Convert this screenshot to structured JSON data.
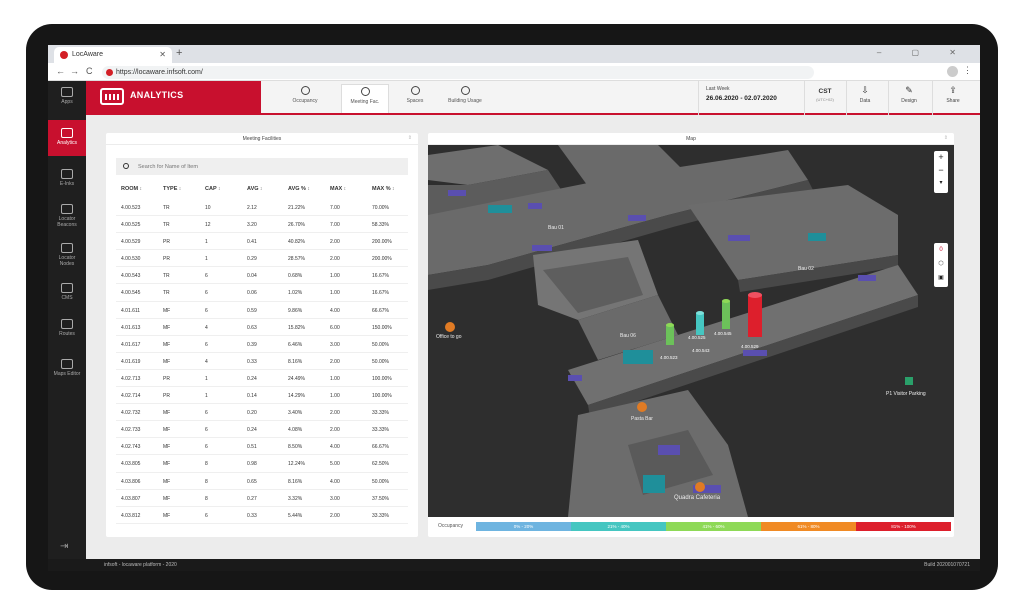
{
  "browser": {
    "tab_title": "LocAware",
    "tab_close": "✕",
    "new_tab": "+",
    "back": "←",
    "forward": "→",
    "reload": "C",
    "url": "https://locaware.infsoft.com/",
    "window_controls": "– ▢ ✕",
    "menu": "⋮"
  },
  "sidebar": {
    "items": [
      {
        "label": "Apps",
        "icon": "apps-icon"
      },
      {
        "label": "Analytics",
        "icon": "analytics-icon"
      },
      {
        "label": "E-Inks",
        "icon": "eink-icon"
      },
      {
        "label": "Locator Beacons",
        "icon": "beacon-icon"
      },
      {
        "label": "Locator Nodes",
        "icon": "node-icon"
      },
      {
        "label": "CMS",
        "icon": "cms-icon"
      },
      {
        "label": "Routes",
        "icon": "routes-icon"
      },
      {
        "label": "Maps Editor",
        "icon": "map-editor-icon"
      }
    ],
    "exit": "⇥"
  },
  "header": {
    "title": "ANALYTICS",
    "tabs": [
      "Occupancy",
      "Meeting Fac.",
      "Spaces",
      "Building Usage"
    ],
    "date_label": "Last Week",
    "date_range": "26.06.2020 - 02.07.2020",
    "timezone": "CST",
    "timezone_sub": "(UTC+02)",
    "buttons": [
      {
        "label": "Data",
        "glyph": "⇩"
      },
      {
        "label": "Design",
        "glyph": "✎"
      },
      {
        "label": "Share",
        "glyph": "⇪"
      }
    ]
  },
  "facilities": {
    "title": "Meeting Facilities",
    "pin": "⇕",
    "search_placeholder": "Search for Name of Item",
    "columns": [
      "ROOM",
      "TYPE",
      "CAP",
      "AVG",
      "AVG %",
      "MAX",
      "MAX %"
    ],
    "rows": [
      [
        "4.00.523",
        "TR",
        "10",
        "2.12",
        "21.22%",
        "7.00",
        "70.00%"
      ],
      [
        "4.00.525",
        "TR",
        "12",
        "3.20",
        "26.70%",
        "7.00",
        "58.33%"
      ],
      [
        "4.00.529",
        "PR",
        "1",
        "0.41",
        "40.82%",
        "2.00",
        "200.00%"
      ],
      [
        "4.00.530",
        "PR",
        "1",
        "0.29",
        "28.57%",
        "2.00",
        "200.00%"
      ],
      [
        "4.00.543",
        "TR",
        "6",
        "0.04",
        "0.68%",
        "1.00",
        "16.67%"
      ],
      [
        "4.00.545",
        "TR",
        "6",
        "0.06",
        "1.02%",
        "1.00",
        "16.67%"
      ],
      [
        "4.01.611",
        "MF",
        "6",
        "0.59",
        "9.86%",
        "4.00",
        "66.67%"
      ],
      [
        "4.01.613",
        "MF",
        "4",
        "0.63",
        "15.82%",
        "6.00",
        "150.00%"
      ],
      [
        "4.01.617",
        "MF",
        "6",
        "0.39",
        "6.46%",
        "3.00",
        "50.00%"
      ],
      [
        "4.01.619",
        "MF",
        "4",
        "0.33",
        "8.16%",
        "2.00",
        "50.00%"
      ],
      [
        "4.02.713",
        "PR",
        "1",
        "0.24",
        "24.49%",
        "1.00",
        "100.00%"
      ],
      [
        "4.02.714",
        "PR",
        "1",
        "0.14",
        "14.29%",
        "1.00",
        "100.00%"
      ],
      [
        "4.02.732",
        "MF",
        "6",
        "0.20",
        "3.40%",
        "2.00",
        "33.33%"
      ],
      [
        "4.02.733",
        "MF",
        "6",
        "0.24",
        "4.08%",
        "2.00",
        "33.33%"
      ],
      [
        "4.02.743",
        "MF",
        "6",
        "0.51",
        "8.50%",
        "4.00",
        "66.67%"
      ],
      [
        "4.03.805",
        "MF",
        "8",
        "0.98",
        "12.24%",
        "5.00",
        "62.50%"
      ],
      [
        "4.03.806",
        "MF",
        "8",
        "0.65",
        "8.16%",
        "4.00",
        "50.00%"
      ],
      [
        "4.03.807",
        "MF",
        "8",
        "0.27",
        "3.32%",
        "3.00",
        "37.50%"
      ],
      [
        "4.03.812",
        "MF",
        "6",
        "0.33",
        "5.44%",
        "2.00",
        "33.33%"
      ]
    ]
  },
  "map": {
    "title": "Map",
    "pin": "⇕",
    "zoom_in": "+",
    "zoom_out": "−",
    "compass": "▾",
    "layer_toggle": "0",
    "place_labels": [
      "Bau 01",
      "Bau 02",
      "Bau 06",
      "Office to go",
      "Pasta Bar",
      "Quadra Cafeteria",
      "P1 Visitor Parking"
    ],
    "room_markers": [
      "4.00.523",
      "4.00.525",
      "4.00.543",
      "4.00.545",
      "4.00.529"
    ],
    "legend_title": "Occupancy",
    "legend": [
      {
        "label": "0% - 20%",
        "color": "#6eb4e0"
      },
      {
        "label": "21% - 40%",
        "color": "#45c6c1"
      },
      {
        "label": "41% - 60%",
        "color": "#8ed957"
      },
      {
        "label": "61% - 80%",
        "color": "#f08a24"
      },
      {
        "label": "81% - 100%",
        "color": "#dd1f2c"
      }
    ]
  },
  "footer": {
    "left": "infsoft - locaware platform - 2020",
    "right": "Build 202001070721"
  },
  "colors": {
    "brand": "#c8102e",
    "sidebar": "#1f1f1f",
    "room": "#5a4fb0",
    "lounge": "#1f8f9a"
  }
}
